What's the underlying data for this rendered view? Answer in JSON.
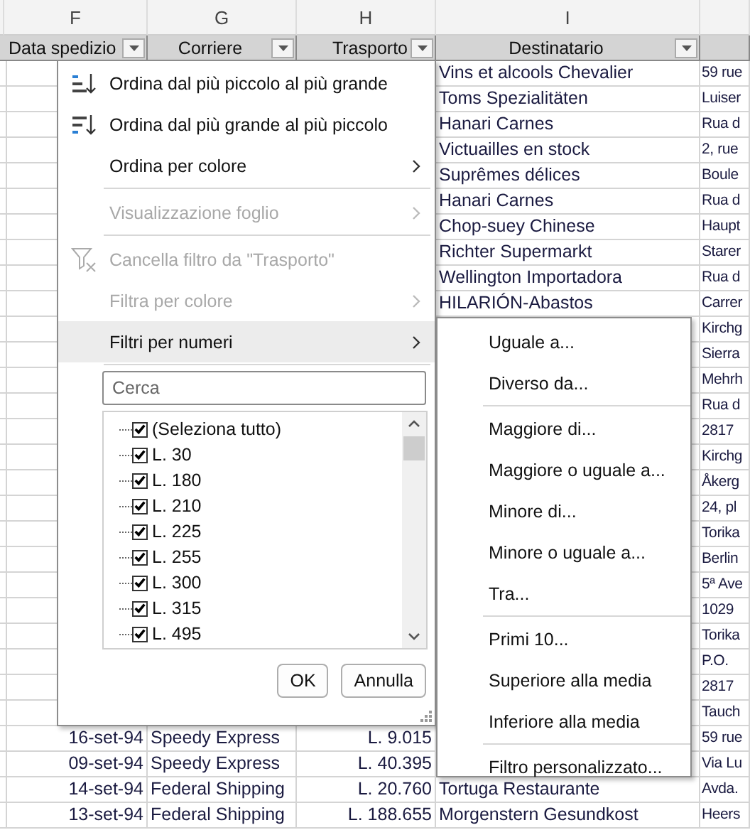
{
  "sheet": {
    "column_letters": [
      "F",
      "G",
      "H",
      "I"
    ],
    "headers": [
      "Data spedizio",
      "Corriere",
      "Trasporto",
      "Destinatario"
    ],
    "rows": [
      {
        "destinatario": "Vins et alcools Chevalier",
        "column_j": "59 rue"
      },
      {
        "destinatario": "Toms Spezialitäten",
        "column_j": "Luiser"
      },
      {
        "destinatario": "Hanari Carnes",
        "column_j": "Rua d"
      },
      {
        "destinatario": "Victuailles en stock",
        "column_j": "2, rue"
      },
      {
        "destinatario": "Suprêmes délices",
        "column_j": "Boule"
      },
      {
        "destinatario": "Hanari Carnes",
        "column_j": "Rua d"
      },
      {
        "destinatario": "Chop-suey Chinese",
        "column_j": "Haupt"
      },
      {
        "destinatario": "Richter Supermarkt",
        "column_j": "Starer"
      },
      {
        "destinatario": "Wellington Importadora",
        "column_j": "Rua d"
      },
      {
        "destinatario": "HILARIÓN-Abastos",
        "column_j": "Carrer"
      },
      {
        "column_j": "Kirchg"
      },
      {
        "column_j": "Sierra"
      },
      {
        "column_j": "Mehrh"
      },
      {
        "column_j": "Rua d"
      },
      {
        "column_j": "2817"
      },
      {
        "column_j": "Kirchg"
      },
      {
        "column_j": "Åkerg"
      },
      {
        "column_j": "24, pl"
      },
      {
        "column_j": "Torika"
      },
      {
        "column_j": "Berlin"
      },
      {
        "column_j": "5ª Ave"
      },
      {
        "column_j": "1029"
      },
      {
        "column_j": "Torika"
      },
      {
        "column_j": "P.O."
      },
      {
        "column_j": "2817"
      },
      {
        "column_j": "Tauch"
      },
      {
        "data_spedizione": "16-set-94",
        "corriere": "Speedy Express",
        "trasporto": "L. 9.015",
        "column_j": "59 rue"
      },
      {
        "data_spedizione": "09-set-94",
        "corriere": "Speedy Express",
        "trasporto": "L. 40.395",
        "column_j": "Via Lu"
      },
      {
        "data_spedizione": "14-set-94",
        "corriere": "Federal Shipping",
        "trasporto": "L. 20.760",
        "destinatario": "Tortuga Restaurante",
        "column_j": "Avda."
      },
      {
        "data_spedizione": "13-set-94",
        "corriere": "Federal Shipping",
        "trasporto": "L. 188.655",
        "destinatario": "Morgenstern Gesundkost",
        "column_j": "Heers"
      }
    ]
  },
  "filter_menu": {
    "groups": [
      [
        {
          "label": "Ordina dal più piccolo al più grande",
          "submenu": false,
          "disabled": false,
          "selected": false
        },
        {
          "label": "Ordina dal più grande al più piccolo",
          "submenu": false,
          "disabled": false,
          "selected": false
        },
        {
          "label": "Ordina per colore",
          "submenu": true,
          "disabled": false,
          "selected": false
        }
      ],
      [
        {
          "label": "Visualizzazione foglio",
          "submenu": true,
          "disabled": true,
          "selected": false
        }
      ],
      [
        {
          "label": "Cancella filtro da \"Trasporto\"",
          "submenu": false,
          "disabled": true,
          "selected": false
        },
        {
          "label": "Filtra per colore",
          "submenu": true,
          "disabled": true,
          "selected": false
        },
        {
          "label": "Filtri per numeri",
          "submenu": true,
          "disabled": false,
          "selected": true
        }
      ]
    ],
    "search": {
      "placeholder": "Cerca"
    },
    "values": [
      {
        "label": "(Seleziona tutto)",
        "checked": true
      },
      {
        "label": "L. 30",
        "checked": true
      },
      {
        "label": "L. 180",
        "checked": true
      },
      {
        "label": "L. 210",
        "checked": true
      },
      {
        "label": "L. 225",
        "checked": true
      },
      {
        "label": "L. 255",
        "checked": true
      },
      {
        "label": "L. 300",
        "checked": true
      },
      {
        "label": "L. 315",
        "checked": true
      },
      {
        "label": "L. 495",
        "checked": true
      }
    ],
    "buttons": [
      "OK",
      "Annulla"
    ]
  },
  "number_filters_menu": {
    "groups": [
      [
        "Uguale a...",
        "Diverso da..."
      ],
      [
        "Maggiore di...",
        "Maggiore o uguale a...",
        "Minore di...",
        "Minore o uguale a...",
        "Tra..."
      ],
      [
        "Primi 10...",
        "Superiore alla media",
        "Inferiore alla media"
      ],
      [
        "Filtro personalizzato..."
      ]
    ]
  }
}
